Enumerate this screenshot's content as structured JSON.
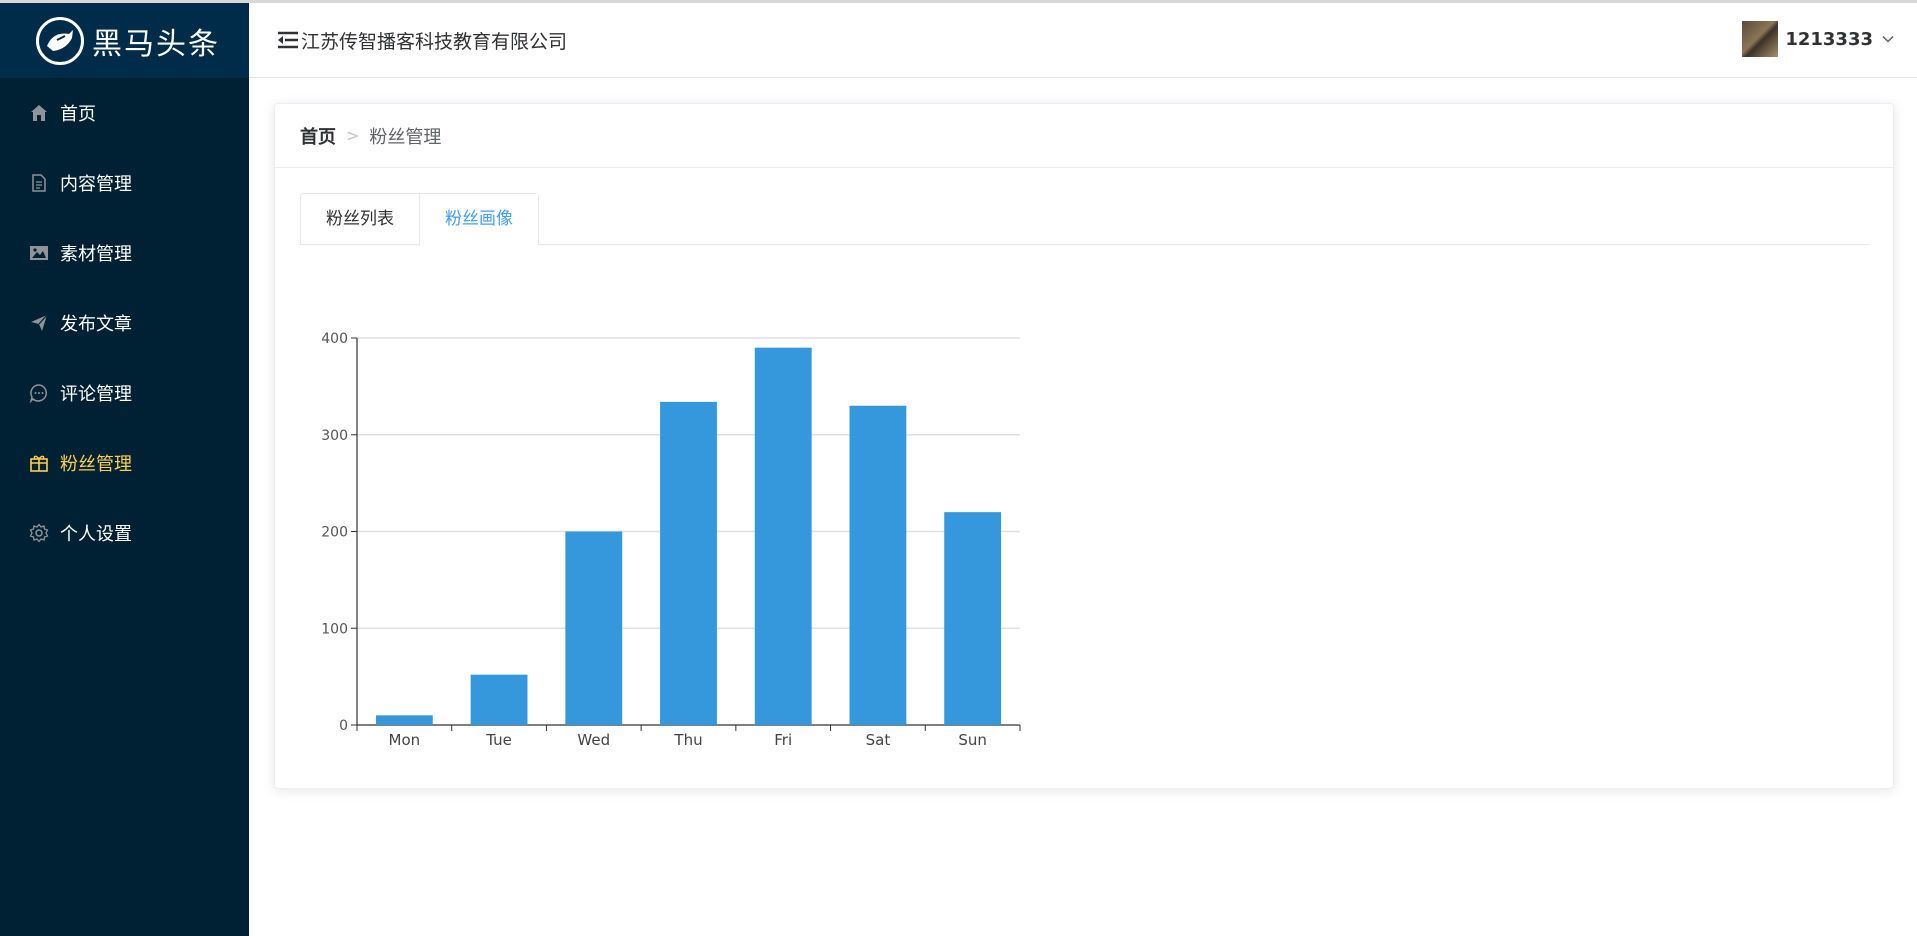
{
  "app": {
    "logo_text": "黑马头条",
    "company": "江苏传智播客科技教育有限公司"
  },
  "sidebar": {
    "items": [
      {
        "label": "首页",
        "icon": "home-icon"
      },
      {
        "label": "内容管理",
        "icon": "document-icon"
      },
      {
        "label": "素材管理",
        "icon": "picture-icon"
      },
      {
        "label": "发布文章",
        "icon": "send-icon"
      },
      {
        "label": "评论管理",
        "icon": "chat-icon"
      },
      {
        "label": "粉丝管理",
        "icon": "present-icon",
        "active": true
      },
      {
        "label": "个人设置",
        "icon": "setting-icon"
      }
    ]
  },
  "user": {
    "name": "1213333"
  },
  "breadcrumb": {
    "home": "首页",
    "current": "粉丝管理"
  },
  "tabs": [
    {
      "label": "粉丝列表",
      "active": false
    },
    {
      "label": "粉丝画像",
      "active": true
    }
  ],
  "colors": {
    "sidebar_bg": "#002033",
    "logo_bg": "#002b49",
    "active_menu": "#ffd04b",
    "active_tab": "#409eff",
    "bar": "#3598dc"
  },
  "chart_data": {
    "type": "bar",
    "categories": [
      "Mon",
      "Tue",
      "Wed",
      "Thu",
      "Fri",
      "Sat",
      "Sun"
    ],
    "values": [
      10,
      52,
      200,
      334,
      390,
      330,
      220
    ],
    "ylim": [
      0,
      400
    ],
    "yticks": [
      0,
      100,
      200,
      300,
      400
    ],
    "grid": true,
    "legend": "none"
  }
}
